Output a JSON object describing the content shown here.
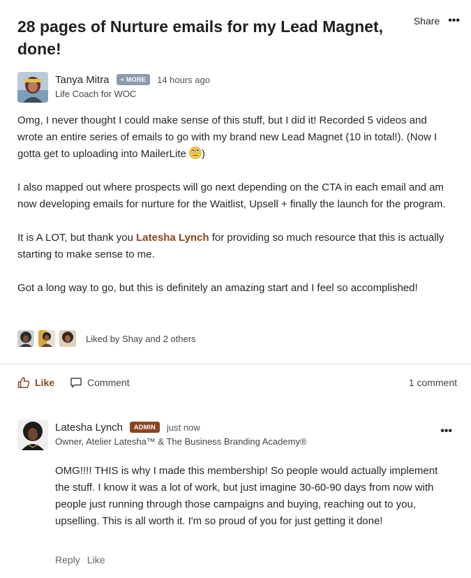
{
  "post": {
    "title": "28 pages of Nurture emails for my Lead Magnet, done!",
    "share_label": "Share",
    "more_label": "•••",
    "author": {
      "name": "Tanya Mitra",
      "badge": "+ MORE",
      "timestamp": "14 hours ago",
      "subtitle": "Life Coach for WOC"
    },
    "body": {
      "p1_before_emoji": "Omg, I never thought I could make sense of this stuff, but I did it! Recorded 5 videos and wrote an entire series of emails to go with my brand new Lead Magnet (10 in total!). (Now I gotta get to uploading into MailerLite ",
      "p1_after_emoji": ")",
      "p2": "I also mapped out where prospects will go next depending on the CTA in each email and am now developing emails for nurture for the Waitlist, Upsell + finally the launch for the program.",
      "p3_before": "It is A LOT, but thank you ",
      "p3_mention": "Latesha Lynch",
      "p3_after": " for providing so much resource that this is actually starting to make sense to me.",
      "p4": "Got a long way to go, but this is definitely an amazing start and I feel so accomplished!"
    },
    "liked_by": "Liked by Shay and 2 others",
    "like_label": "Like",
    "comment_label": "Comment",
    "comment_count": "1 comment"
  },
  "comment": {
    "author": {
      "name": "Latesha Lynch",
      "badge": "ADMIN",
      "timestamp": "just now",
      "subtitle": "Owner, Atelier Latesha™ & The Business Branding Academy®"
    },
    "more_label": "•••",
    "body": "OMG!!!! THIS is why I made this membership! So people would actually implement the stuff. I know it was a lot of work, but just imagine 30-60-90 days from now with people just running through those campaigns and buying, reaching out to you, upselling. This is all worth it. I'm so proud of you for just getting it done!",
    "reply_label": "Reply",
    "like_label": "Like"
  },
  "colors": {
    "accent": "#8a4520",
    "more_badge": "#8c9bae",
    "divider": "#e4e4e4"
  }
}
